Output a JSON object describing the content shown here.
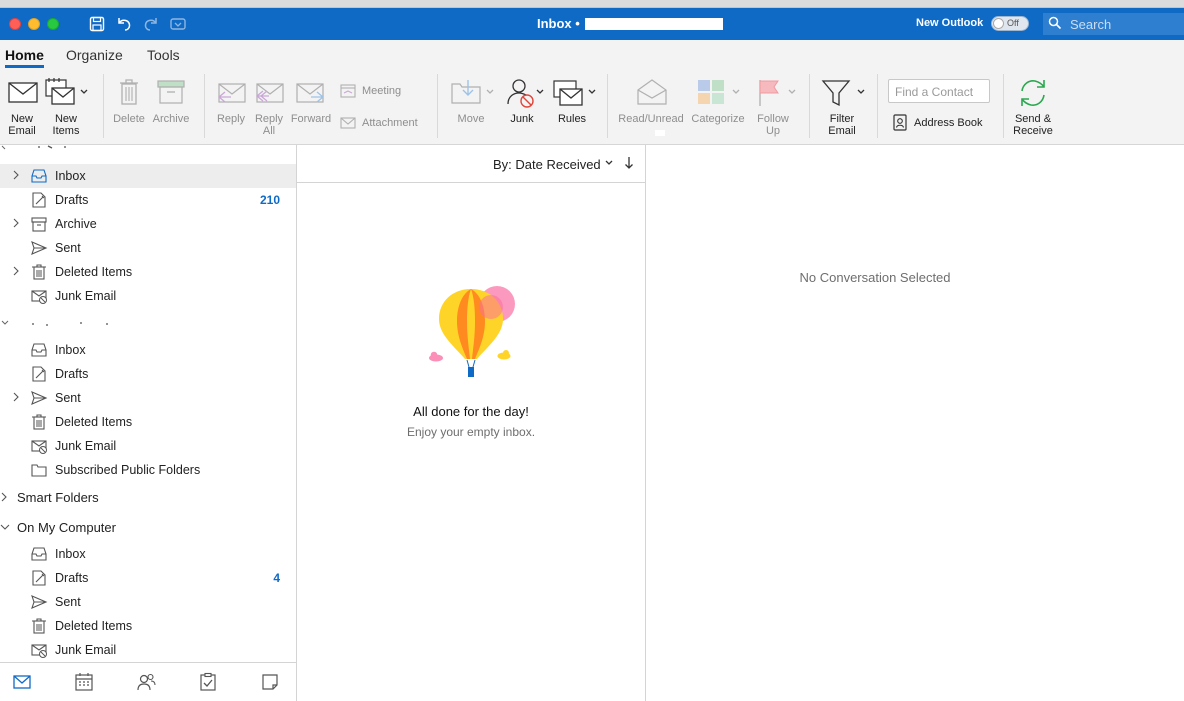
{
  "titlebar": {
    "title": "Inbox •",
    "new_outlook_label": "New Outlook",
    "toggle_state": "Off",
    "search_placeholder": "Search"
  },
  "tabs": [
    {
      "label": "Home",
      "active": true
    },
    {
      "label": "Organize",
      "active": false
    },
    {
      "label": "Tools",
      "active": false
    }
  ],
  "ribbon": {
    "new_email": [
      "New",
      "Email"
    ],
    "new_items": [
      "New",
      "Items"
    ],
    "delete": "Delete",
    "archive": "Archive",
    "reply": "Reply",
    "reply_all": [
      "Reply",
      "All"
    ],
    "forward": "Forward",
    "meeting": "Meeting",
    "attachment": "Attachment",
    "move": "Move",
    "junk": "Junk",
    "rules": "Rules",
    "read_unread": "Read/Unread",
    "categorize": "Categorize",
    "follow_up": [
      "Follow",
      "Up"
    ],
    "filter_email": [
      "Filter",
      "Email"
    ],
    "find_contact_placeholder": "Find a Contact",
    "address_book": "Address Book",
    "send_receive": [
      "Send &",
      "Receive"
    ]
  },
  "sidebar": {
    "account1_folders": [
      {
        "label": "Inbox",
        "count": "",
        "icon": "inbox-icon",
        "expandable": true,
        "selected": true
      },
      {
        "label": "Drafts",
        "count": "210",
        "icon": "drafts-icon",
        "expandable": false
      },
      {
        "label": "Archive",
        "count": "",
        "icon": "archive-icon",
        "expandable": true
      },
      {
        "label": "Sent",
        "count": "",
        "icon": "sent-icon",
        "expandable": false
      },
      {
        "label": "Deleted Items",
        "count": "",
        "icon": "trash-icon",
        "expandable": true
      },
      {
        "label": "Junk Email",
        "count": "",
        "icon": "junk-icon",
        "expandable": false
      }
    ],
    "account2_folders": [
      {
        "label": "Inbox",
        "count": "",
        "icon": "inbox-icon",
        "expandable": false
      },
      {
        "label": "Drafts",
        "count": "",
        "icon": "drafts-icon",
        "expandable": false
      },
      {
        "label": "Sent",
        "count": "",
        "icon": "sent-icon",
        "expandable": true
      },
      {
        "label": "Deleted Items",
        "count": "",
        "icon": "trash-icon",
        "expandable": false
      },
      {
        "label": "Junk Email",
        "count": "",
        "icon": "junk-icon",
        "expandable": false
      },
      {
        "label": "Subscribed Public Folders",
        "count": "",
        "icon": "folder-icon",
        "expandable": false
      }
    ],
    "smart_folders": "Smart Folders",
    "on_my_computer": "On My Computer",
    "local_folders": [
      {
        "label": "Inbox",
        "count": "",
        "icon": "inbox-icon"
      },
      {
        "label": "Drafts",
        "count": "4",
        "icon": "drafts-icon"
      },
      {
        "label": "Sent",
        "count": "",
        "icon": "sent-icon"
      },
      {
        "label": "Deleted Items",
        "count": "",
        "icon": "trash-icon"
      },
      {
        "label": "Junk Email",
        "count": "",
        "icon": "junk-icon"
      }
    ]
  },
  "message_list": {
    "sort_label": "By: Date Received",
    "empty_title": "All done for the day!",
    "empty_subtitle": "Enjoy your empty inbox."
  },
  "reading_pane": {
    "placeholder": "No Conversation Selected"
  },
  "colors": {
    "accent": "#0f6ac6",
    "count_blue": "#0f6ac6"
  }
}
